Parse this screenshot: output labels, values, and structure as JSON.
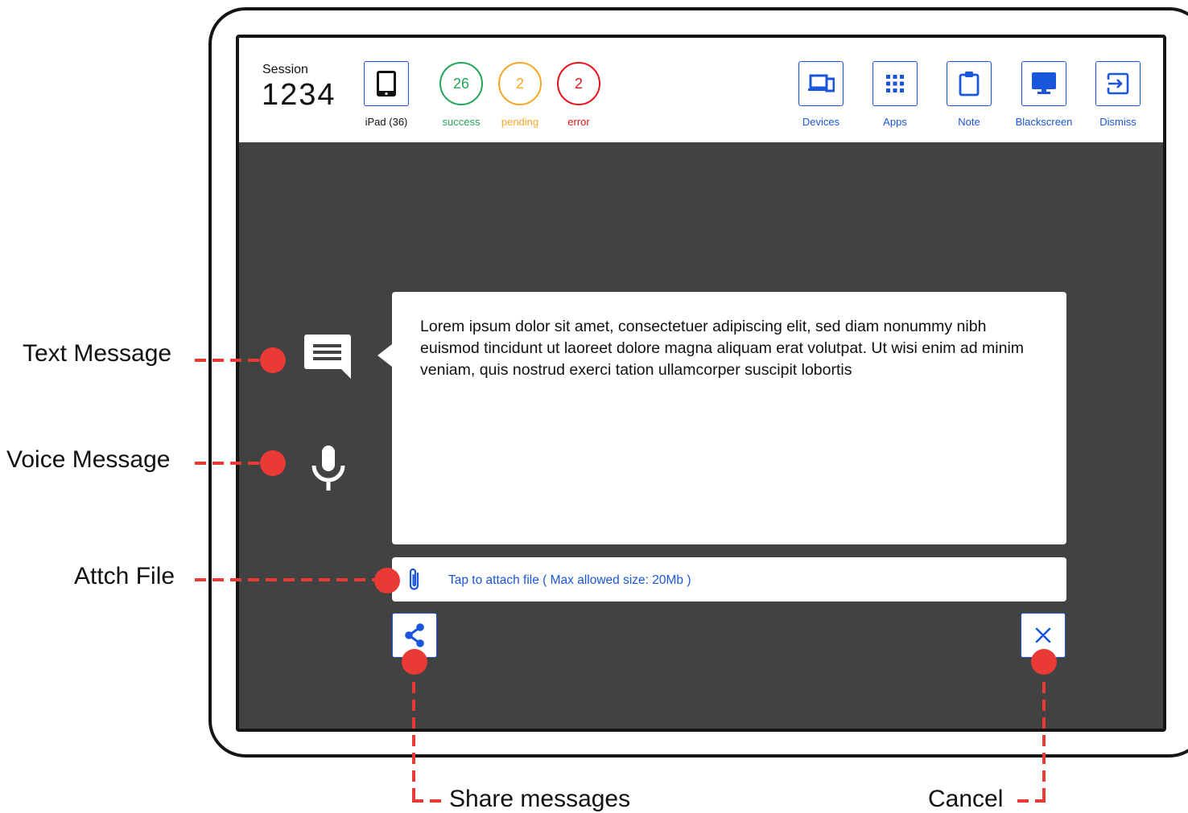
{
  "session": {
    "label": "Session",
    "number": "1234"
  },
  "device_tile": {
    "icon": "tablet-icon",
    "caption": "iPad (36)"
  },
  "status": [
    {
      "name": "success",
      "count": "26",
      "label": "success",
      "color": "#23a55a"
    },
    {
      "name": "pending",
      "count": "2",
      "label": "pending",
      "color": "#f5a623"
    },
    {
      "name": "error",
      "count": "2",
      "label": "error",
      "color": "#e8141b"
    }
  ],
  "toolbar": [
    {
      "name": "devices",
      "icon": "devices-icon",
      "label": "Devices"
    },
    {
      "name": "apps",
      "icon": "apps-grid-icon",
      "label": "Apps"
    },
    {
      "name": "note",
      "icon": "clipboard-icon",
      "label": "Note"
    },
    {
      "name": "blackscreen",
      "icon": "monitor-icon",
      "label": "Blackscreen"
    },
    {
      "name": "dismiss",
      "icon": "exit-icon",
      "label": "Dismiss"
    }
  ],
  "message": {
    "text": "Lorem ipsum dolor sit amet, consectetuer adipiscing elit, sed diam nonummy nibh euismod tincidunt ut laoreet dolore magna aliquam erat volutpat. Ut wisi enim ad minim veniam, quis nostrud exerci tation ullamcorper suscipit lobortis"
  },
  "attach": {
    "icon": "paperclip-icon",
    "text": "Tap to attach file ( Max allowed size: 20Mb )"
  },
  "actions": {
    "share_icon": "share-icon",
    "cancel_icon": "close-icon"
  },
  "side_icons": {
    "text": "chat-bubble-icon",
    "voice": "microphone-icon"
  },
  "annotations": {
    "text_message": "Text Message",
    "voice_message": "Voice Message",
    "attach_file": "Attch File",
    "share_messages": "Share messages",
    "cancel": "Cancel"
  },
  "colors": {
    "accent": "#1a56db",
    "annotation": "#ea3a35",
    "screen_bg": "#424242"
  }
}
